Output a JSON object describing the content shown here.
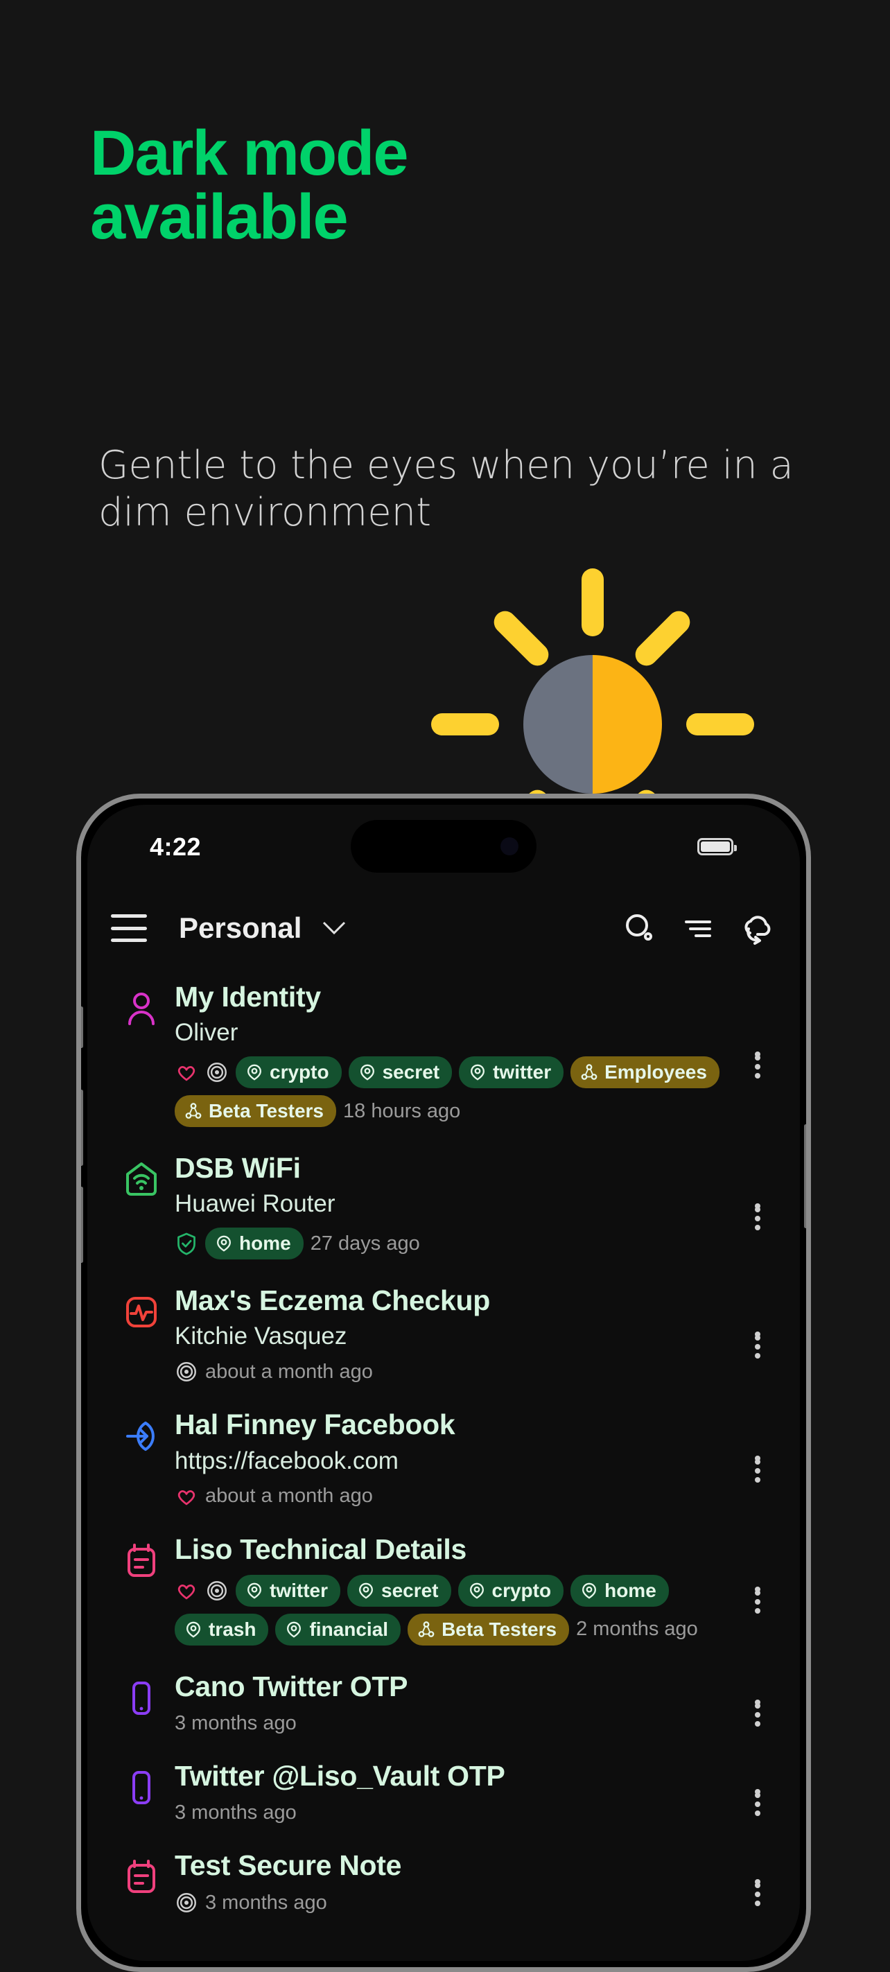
{
  "marketing": {
    "headline_line1": "Dark mode",
    "headline_line2": "available",
    "headline_color": "#00d26a",
    "subhead": "Gentle to the eyes when you’re in a dim environment",
    "subhead_color": "#d2d2d2",
    "background_color": "#151515"
  },
  "illustration": {
    "name": "sun-half-dark",
    "left_half_color": "#6b7280",
    "right_half_color": "#fcb415",
    "ray_color": "#fdd130"
  },
  "phone": {
    "status_bar": {
      "time": "4:22",
      "battery_icon": "battery-icon"
    },
    "toolbar": {
      "menu_icon": "hamburger-menu-icon",
      "title": "Personal",
      "caret_icon": "chevron-down-icon",
      "search_icon": "search-icon",
      "sort_icon": "sort-icon",
      "sync_icon": "cloud-sync-icon"
    },
    "list": [
      {
        "icon": "person-outline-icon",
        "icon_color": "#d832c8",
        "title": "My Identity",
        "subtitle": "Oliver",
        "status_icons": [
          {
            "name": "heart-icon",
            "color": "#e8336d"
          },
          {
            "name": "fingerprint-icon",
            "color": "#cfcfcf"
          }
        ],
        "tags": [
          "crypto",
          "secret",
          "twitter"
        ],
        "groups": [
          "Employees",
          "Beta Testers"
        ],
        "ago": "18 hours ago"
      },
      {
        "icon": "wifi-home-icon",
        "icon_color": "#39c463",
        "title": "DSB WiFi",
        "subtitle": "Huawei Router",
        "status_icons": [
          {
            "name": "shield-check-icon",
            "color": "#24b56a"
          }
        ],
        "tags": [
          "home"
        ],
        "groups": [],
        "ago": "27 days ago"
      },
      {
        "icon": "heartbeat-icon",
        "icon_color": "#f0423a",
        "title": "Max's Eczema Checkup",
        "subtitle": "Kitchie Vasquez",
        "status_icons": [
          {
            "name": "fingerprint-icon",
            "color": "#cfcfcf"
          }
        ],
        "tags": [],
        "groups": [],
        "ago": "about a month ago"
      },
      {
        "icon": "login-arrow-icon",
        "icon_color": "#3b7dfb",
        "title": "Hal Finney Facebook",
        "subtitle": "https://facebook.com",
        "status_icons": [
          {
            "name": "heart-icon",
            "color": "#e8336d"
          }
        ],
        "tags": [],
        "groups": [],
        "ago": "about a month ago"
      },
      {
        "icon": "secure-note-icon",
        "icon_color": "#f0407d",
        "title": "Liso Technical Details",
        "subtitle": "",
        "status_icons": [
          {
            "name": "heart-icon",
            "color": "#e8336d"
          },
          {
            "name": "fingerprint-icon",
            "color": "#cfcfcf"
          }
        ],
        "tags": [
          "twitter",
          "secret",
          "crypto",
          "home",
          "trash",
          "financial"
        ],
        "groups": [
          "Beta Testers"
        ],
        "ago": "2 months ago"
      },
      {
        "icon": "otp-phone-icon",
        "icon_color": "#8b3df5",
        "title": "Cano Twitter OTP",
        "subtitle": "",
        "status_icons": [],
        "tags": [],
        "groups": [],
        "ago": "3 months ago"
      },
      {
        "icon": "otp-phone-icon",
        "icon_color": "#8b3df5",
        "title": "Twitter @Liso_Vault OTP",
        "subtitle": "",
        "status_icons": [],
        "tags": [],
        "groups": [],
        "ago": "3 months ago"
      },
      {
        "icon": "secure-note-icon",
        "icon_color": "#f0407d",
        "title": "Test Secure Note",
        "subtitle": "",
        "status_icons": [
          {
            "name": "fingerprint-icon",
            "color": "#cfcfcf"
          }
        ],
        "tags": [],
        "groups": [],
        "ago": "3 months ago"
      }
    ],
    "kebab_icon": "more-vertical-icon",
    "tag_icon": "tag-pin-icon",
    "group_icon": "group-share-icon",
    "chip_tag_color": "#14512f",
    "chip_group_color": "#7a6310"
  }
}
